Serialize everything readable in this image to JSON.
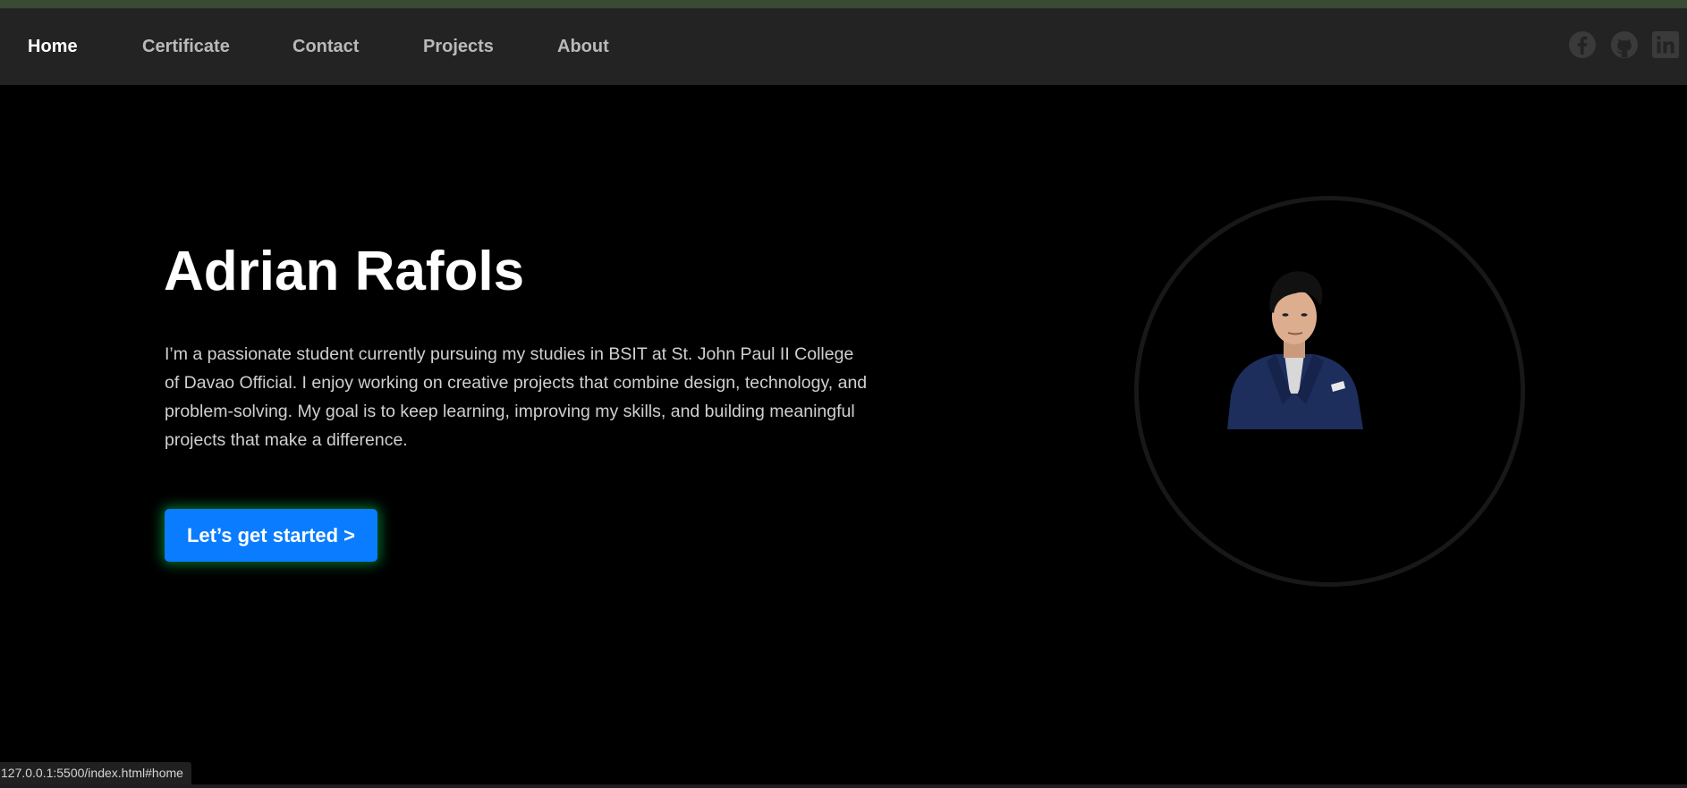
{
  "nav": {
    "items": [
      {
        "label": "Home",
        "active": true
      },
      {
        "label": "Certificate",
        "active": false
      },
      {
        "label": "Contact",
        "active": false
      },
      {
        "label": "Projects",
        "active": false
      },
      {
        "label": "About",
        "active": false
      }
    ],
    "social_icons": [
      "facebook-icon",
      "github-icon",
      "linkedin-icon"
    ]
  },
  "hero": {
    "title": "Adrian Rafols",
    "description": "I’m a passionate student currently pursuing my studies in BSIT at St. John Paul II College of Davao Official. I enjoy working on creative projects that combine design, technology, and problem-solving. My goal is to keep learning, improving my skills, and building meaningful projects that make a difference.",
    "cta_label": "Let’s get started >"
  },
  "status_bar": {
    "url": "127.0.0.1:5500/index.html#home"
  },
  "colors": {
    "background": "#000000",
    "navbar": "#232323",
    "accent": "#0a7cff",
    "cta_glow": "#00c850",
    "nav_link": "#b9b9b9",
    "nav_active": "#ffffff"
  }
}
